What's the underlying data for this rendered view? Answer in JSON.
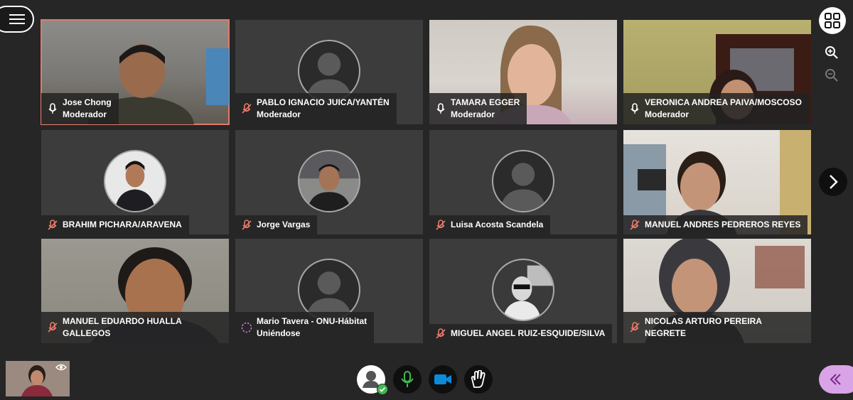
{
  "participants": [
    {
      "name": "Jose Chong",
      "role": "Moderador",
      "mic": "on"
    },
    {
      "name": "PABLO IGNACIO JUICA/YANTÉN",
      "role": "Moderador",
      "mic": "muted"
    },
    {
      "name": "TAMARA EGGER",
      "role": "Moderador",
      "mic": "on"
    },
    {
      "name": "VERONICA ANDREA PAIVA/MOSCOSO",
      "role": "Moderador",
      "mic": "on"
    },
    {
      "name": "BRAHIM PICHARA/ARAVENA",
      "role": "",
      "mic": "muted"
    },
    {
      "name": "Jorge Vargas",
      "role": "",
      "mic": "muted"
    },
    {
      "name": "Luisa Acosta Scandela",
      "role": "",
      "mic": "muted"
    },
    {
      "name": "MANUEL ANDRES PEDREROS REYES",
      "role": "",
      "mic": "muted"
    },
    {
      "name": "MANUEL EDUARDO HUALLA GALLEGOS",
      "role": "",
      "mic": "muted"
    },
    {
      "name": "Mario Tavera - ONU-Hábitat",
      "role": "Uniéndose",
      "mic": "joining"
    },
    {
      "name": "MIGUEL ANGEL RUIZ-ESQUIDE/SILVA",
      "role": "",
      "mic": "muted"
    },
    {
      "name": "NICOLAS ARTURO PEREIRA NEGRETE",
      "role": "",
      "mic": "muted"
    }
  ],
  "colors": {
    "background": "#262626",
    "active_speaker_border": "#e07a6a",
    "mic_on": "#3fb950",
    "muted_icon": "#e87a6a",
    "camera": "#0b8bd8",
    "chat_panel": "#d9a3e8"
  },
  "icons": {
    "menu": "hamburger-icon",
    "grid": "grid-view-icon",
    "zoom_in": "zoom-in-icon",
    "zoom_out": "zoom-out-icon",
    "next": "chevron-right-icon",
    "self_view": "eye-icon",
    "status": "user-status-icon",
    "mic": "microphone-icon",
    "camera": "camera-icon",
    "hand": "raise-hand-icon",
    "chat": "double-chevron-left-icon"
  }
}
